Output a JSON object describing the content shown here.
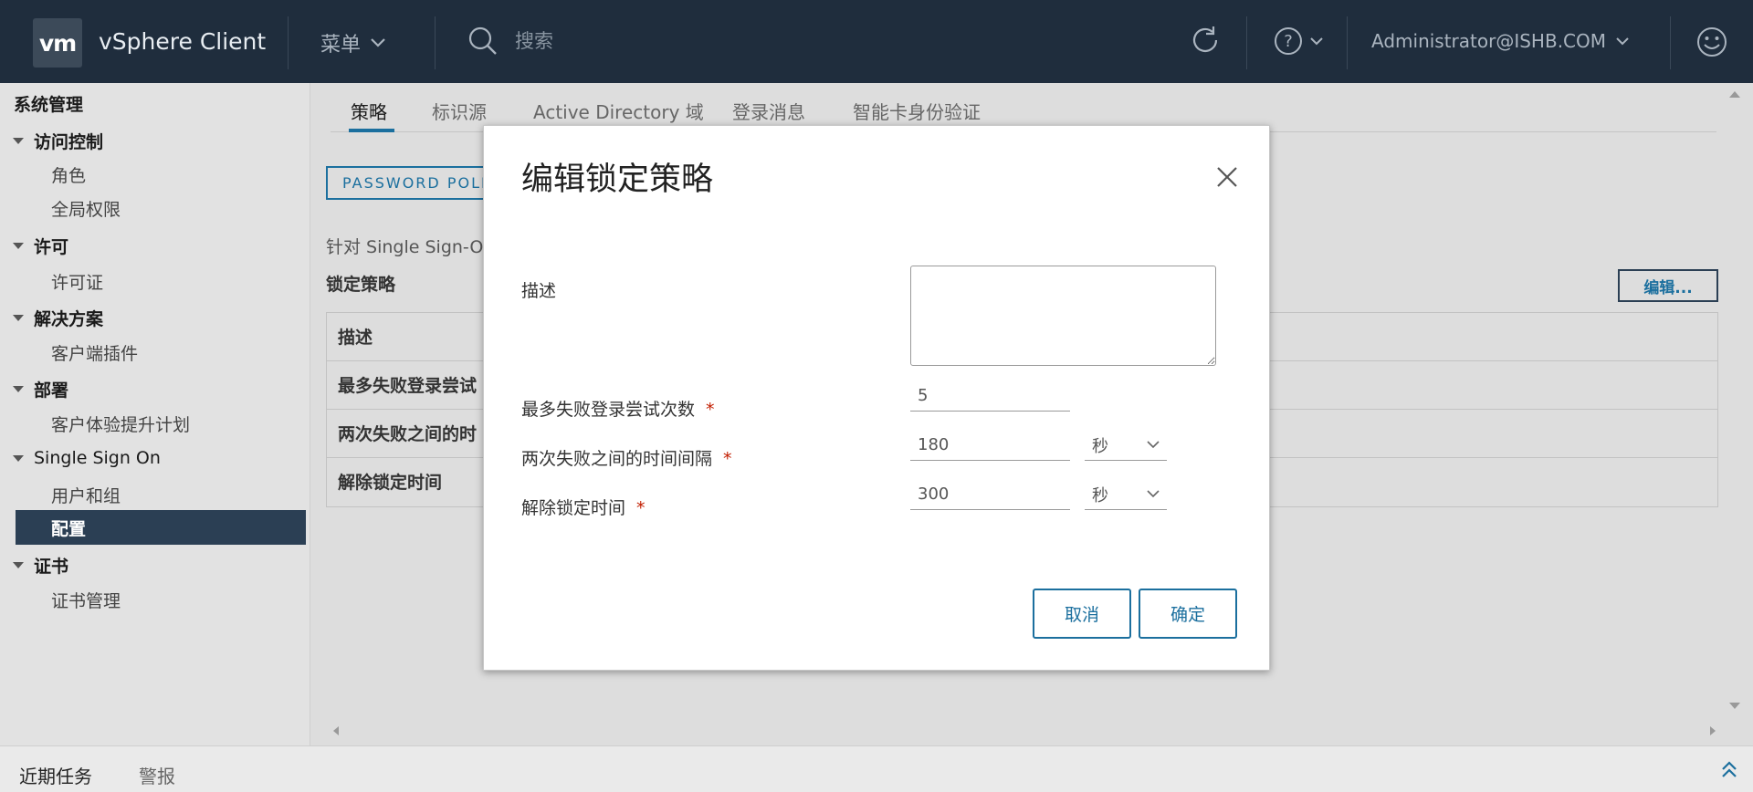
{
  "header": {
    "logo": "vm",
    "app_title": "vSphere Client",
    "menu_label": "菜单",
    "search_placeholder": "搜索",
    "user": "Administrator@ISHB.COM"
  },
  "sidebar": {
    "root": "系统管理",
    "groups": [
      {
        "label": "访问控制",
        "items": [
          "角色",
          "全局权限"
        ]
      },
      {
        "label": "许可",
        "items": [
          "许可证"
        ]
      },
      {
        "label": "解决方案",
        "items": [
          "客户端插件"
        ]
      },
      {
        "label": "部署",
        "items": [
          "客户体验提升计划"
        ]
      },
      {
        "label": "Single Sign On",
        "items": [
          "用户和组",
          "配置"
        ]
      },
      {
        "label": "证书",
        "items": [
          "证书管理"
        ]
      }
    ],
    "active_item": "配置"
  },
  "main": {
    "tabs": [
      "策略",
      "标识源",
      "Active Directory 域",
      "登录消息",
      "智能卡身份验证"
    ],
    "password_policy_button": "PASSWORD POLI",
    "description_text": "针对 Single Sign-O",
    "lockout_title": "锁定策略",
    "edit_button": "编辑...",
    "grid_rows": [
      "描述",
      "最多失败登录尝试",
      "两次失败之间的时",
      "解除锁定时间"
    ]
  },
  "bottom": {
    "tabs": [
      "近期任务",
      "警报"
    ]
  },
  "modal": {
    "title": "编辑锁定策略",
    "fields": {
      "description_label": "描述",
      "description_value": "",
      "max_attempts_label": "最多失败登录尝试次数",
      "max_attempts_value": "5",
      "interval_label": "两次失败之间的时间间隔",
      "interval_value": "180",
      "interval_unit": "秒",
      "unlock_label": "解除锁定时间",
      "unlock_value": "300",
      "unlock_unit": "秒"
    },
    "required_mark": "*",
    "cancel_label": "取消",
    "ok_label": "确定"
  },
  "colors": {
    "header_bg": "#1f2d3d",
    "accent": "#1b6f9e",
    "sidebar_active": "#2b3f54",
    "required": "#c21d00"
  }
}
